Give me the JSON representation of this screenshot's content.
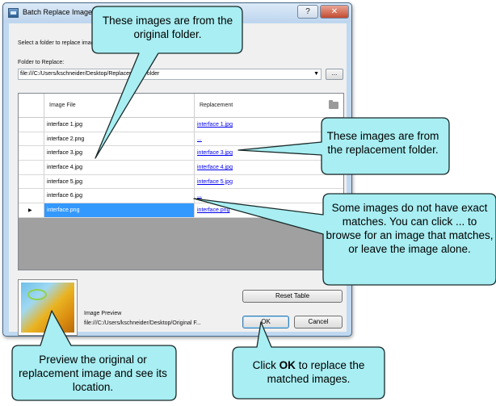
{
  "window": {
    "title": "Batch Replace Images",
    "help_label": "?",
    "close_label": "✕"
  },
  "instruction": "Select a folder to replace images and then edit the links in the grid below.",
  "folder": {
    "label": "Folder to Replace:",
    "value": "file:///C:/Users/kschneider/Desktop/Replacement Folder",
    "browse_label": "..."
  },
  "grid": {
    "columns": [
      "Image File",
      "Replacement"
    ],
    "rows": [
      {
        "image": "interface 1.jpg",
        "replacement": "interface 1.jpg"
      },
      {
        "image": "interface 2.png",
        "replacement": "..."
      },
      {
        "image": "interface 3.jpg",
        "replacement": "interface 3.jpg"
      },
      {
        "image": "interface 4.jpg",
        "replacement": "interface 4.jpg"
      },
      {
        "image": "interface 5.jpg",
        "replacement": "interface 5.jpg"
      },
      {
        "image": "interface 6.jpg",
        "replacement": "..."
      },
      {
        "image": "interface.png",
        "replacement": "interface.png",
        "selected": true
      }
    ],
    "row_pointer": "▶"
  },
  "preview": {
    "label": "Image Preview",
    "path": "file:///C:/Users/kschneider/Desktop/Original F..."
  },
  "buttons": {
    "reset": "Reset Table",
    "ok": "OK",
    "cancel": "Cancel"
  },
  "callouts": {
    "original": "These images are from the original folder.",
    "replacement": "These images are from the replacement folder.",
    "no_match": "Some images do not have exact matches. You can click ... to browse for an image that matches, or leave the image alone.",
    "preview": "Preview the original or replacement image and see its location.",
    "ok_prefix": "Click ",
    "ok_bold": "OK",
    "ok_suffix": " to replace the matched images."
  },
  "colors": {
    "callout_fill": "#a8eef2",
    "callout_stroke": "#1a2a2a",
    "selection": "#3399ff",
    "link": "#0000ee"
  }
}
